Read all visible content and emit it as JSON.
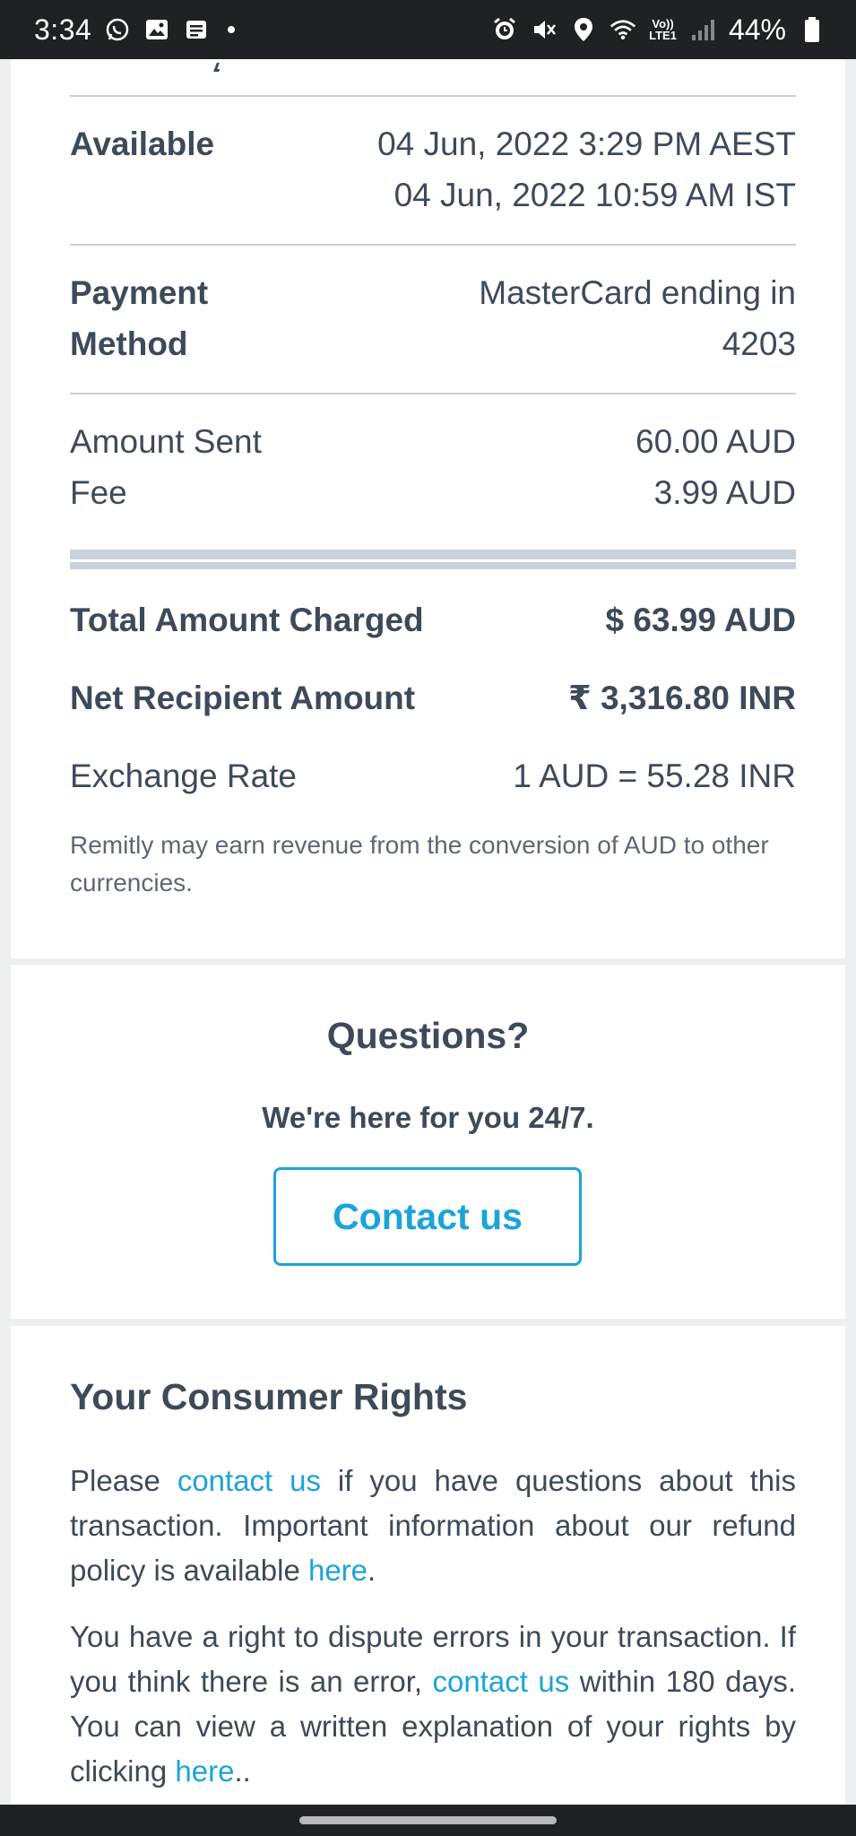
{
  "status_bar": {
    "time": "3:34",
    "network": "Vo))\nLTE1",
    "battery": "44%"
  },
  "details": {
    "available_label": "Available",
    "available_values": [
      "04 Jun, 2022 3:29 PM AEST",
      "04 Jun, 2022 10:59 AM IST"
    ],
    "payment_label_lines": [
      "Payment",
      "Method"
    ],
    "payment_value_lines": [
      "MasterCard ending in",
      "4203"
    ],
    "amount_sent_label": "Amount Sent",
    "amount_sent_value": "60.00 AUD",
    "fee_label": "Fee",
    "fee_value": "3.99 AUD",
    "total_label": "Total Amount Charged",
    "total_value": "$ 63.99 AUD",
    "net_label": "Net Recipient Amount",
    "net_value": "₹ 3,316.80 INR",
    "rate_label": "Exchange Rate",
    "rate_value": "1 AUD = 55.28 INR",
    "note": "Remitly may earn revenue from the conversion of AUD to other currencies."
  },
  "questions": {
    "title": "Questions?",
    "subtitle": "We're here for you 24/7.",
    "button": "Contact us"
  },
  "rights": {
    "title": "Your Consumer Rights",
    "p1_a": "Please ",
    "p1_link1": "contact us",
    "p1_b": " if you have questions about this transaction. Important information about our refund policy is available ",
    "p1_link2": "here",
    "p1_c": ".",
    "p2_a": "You have a right to dispute errors in your transaction. If you think there is an error, ",
    "p2_link1": "contact us",
    "p2_b": " within 180 days. You can view a written explanation of your rights by clicking ",
    "p2_link2": "here",
    "p2_c": ".."
  },
  "colors": {
    "link": "#1ba4d9",
    "text": "#3d4a59",
    "status_bar": "#1f2124"
  }
}
